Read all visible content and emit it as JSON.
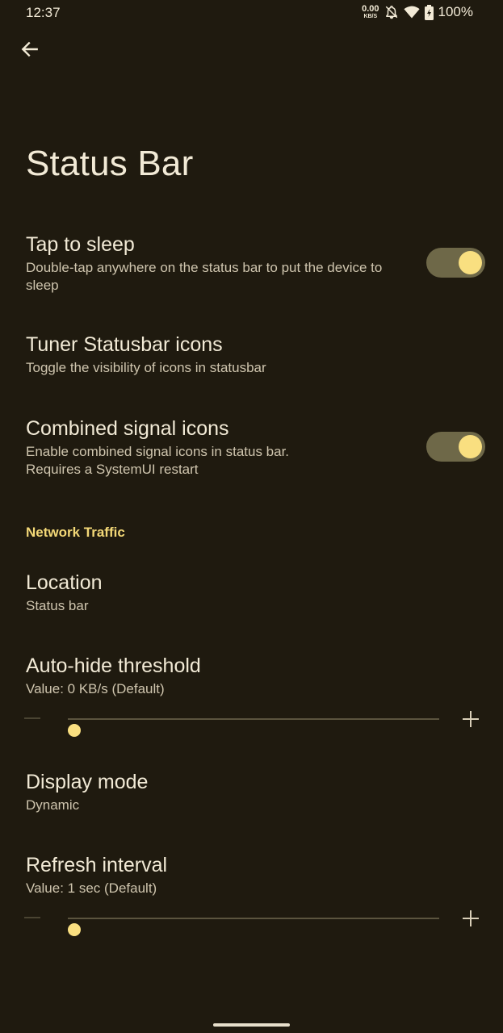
{
  "status_bar": {
    "time": "12:37",
    "net_speed_value": "0.00",
    "net_speed_unit": "KB/S",
    "battery": "100%",
    "icons": [
      "bell-off-icon",
      "wifi-icon",
      "battery-icon"
    ]
  },
  "header": {
    "back_icon": "arrow-back-icon",
    "title": "Status Bar"
  },
  "preferences": [
    {
      "title": "Tap to sleep",
      "summary": "Double-tap anywhere on the status bar to put the device to sleep",
      "switch_on": true
    },
    {
      "title": "Tuner Statusbar icons",
      "summary": "Toggle the visibility of icons in statusbar"
    },
    {
      "title": "Combined signal icons",
      "summary": "Enable combined signal icons in status bar. Requires a SystemUI restart",
      "switch_on": true
    }
  ],
  "network_traffic": {
    "header": "Network Traffic",
    "location": {
      "title": "Location",
      "summary": "Status bar"
    },
    "auto_hide": {
      "title": "Auto-hide threshold",
      "summary": "Value: 0 KB/s (Default)",
      "slider_fraction": 0.0
    },
    "display_mode": {
      "title": "Display mode",
      "summary": "Dynamic"
    },
    "refresh": {
      "title": "Refresh interval",
      "summary": "Value: 1 sec (Default)",
      "slider_fraction": 0.0
    }
  },
  "colors": {
    "background": "#1f1a0f",
    "accent": "#f3d877",
    "switch_track": "#6e6848",
    "switch_thumb": "#f9df80"
  }
}
